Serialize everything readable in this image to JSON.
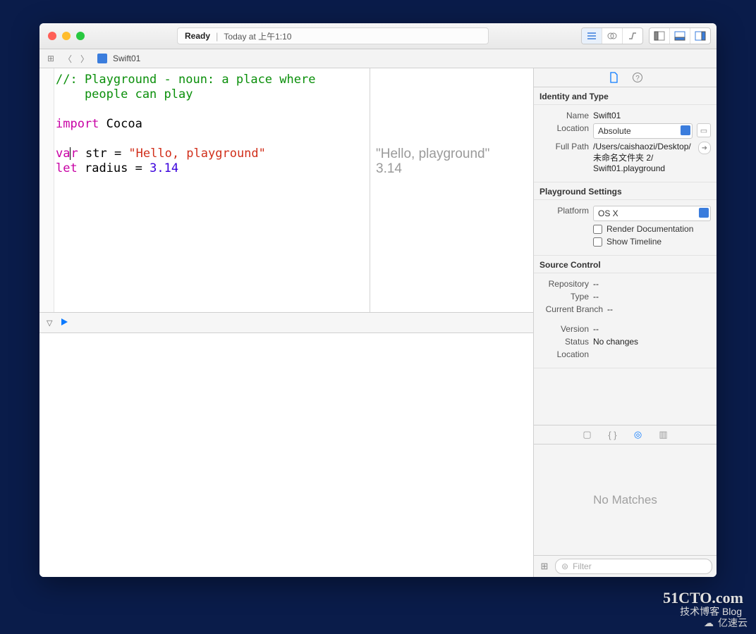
{
  "status": {
    "state": "Ready",
    "timestamp": "Today at 上午1:10"
  },
  "tabbar": {
    "filename": "Swift01"
  },
  "code": {
    "comment_line1": "//: Playground - noun: a place where",
    "comment_line2": "    people can play",
    "kw_import": "import",
    "module": "Cocoa",
    "kw_var": "var",
    "ident_str": "str",
    "eq1": " = ",
    "str_lit": "\"Hello, playground\"",
    "kw_let": "let",
    "ident_radius": "radius",
    "eq2": " = ",
    "num_lit": "3.14"
  },
  "results": {
    "l1": "\"Hello, playground\"",
    "l2": "3.14"
  },
  "inspector": {
    "identity": {
      "title": "Identity and Type",
      "name_label": "Name",
      "name_value": "Swift01",
      "location_label": "Location",
      "location_value": "Absolute",
      "fullpath_label": "Full Path",
      "fullpath_value": "/Users/caishaozi/Desktop/\n未命名文件夹 2/\nSwift01.playground"
    },
    "playground": {
      "title": "Playground Settings",
      "platform_label": "Platform",
      "platform_value": "OS X",
      "render_doc": "Render Documentation",
      "show_timeline": "Show Timeline"
    },
    "scm": {
      "title": "Source Control",
      "repository_label": "Repository",
      "repository_value": "--",
      "type_label": "Type",
      "type_value": "--",
      "branch_label": "Current Branch",
      "branch_value": "--",
      "version_label": "Version",
      "version_value": "--",
      "status_label": "Status",
      "status_value": "No changes",
      "location_label": "Location",
      "location_value": ""
    },
    "nomatch": "No Matches",
    "filter_placeholder": "Filter"
  },
  "watermarks": {
    "w1": "51CTO.com",
    "w2": "技术博客   Blog",
    "w3": "亿速云"
  }
}
